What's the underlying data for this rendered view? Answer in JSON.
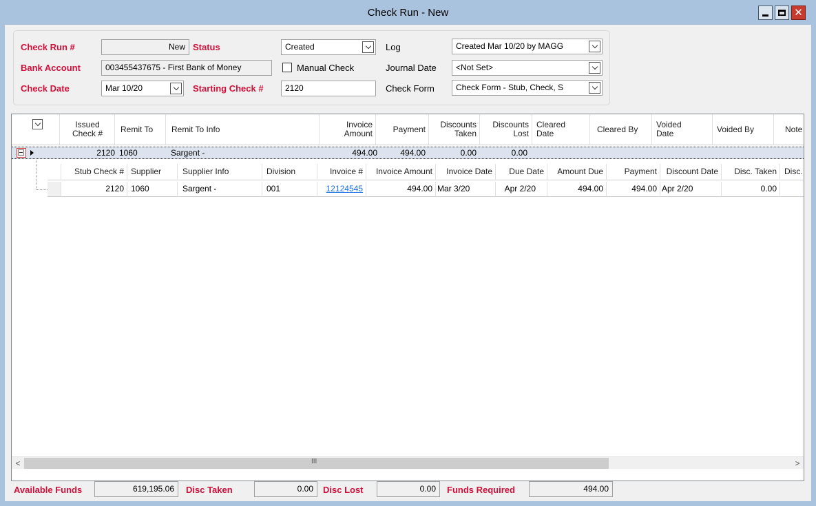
{
  "window": {
    "title": "Check Run - New"
  },
  "header": {
    "check_run_label": "Check Run #",
    "check_run_value": "New",
    "status_label": "Status",
    "status_value": "Created",
    "log_label": "Log",
    "log_value": "Created Mar 10/20 by MAGG",
    "bank_account_label": "Bank Account",
    "bank_account_value": "003455437675 - First Bank of Money",
    "manual_check_label": "Manual Check",
    "journal_date_label": "Journal Date",
    "journal_date_value": "<Not Set>",
    "check_date_label": "Check Date",
    "check_date_value": "Mar 10/20",
    "starting_check_label": "Starting Check #",
    "starting_check_value": "2120",
    "check_form_label": "Check Form",
    "check_form_value": "Check Form - Stub, Check, S"
  },
  "grid": {
    "columns": {
      "issued_check_1": "Issued",
      "issued_check_2": "Check #",
      "remit_to": "Remit To",
      "remit_to_info": "Remit To Info",
      "invoice_amount_1": "Invoice",
      "invoice_amount_2": "Amount",
      "payment": "Payment",
      "discounts_taken_1": "Discounts",
      "discounts_taken_2": "Taken",
      "discounts_lost_1": "Discounts",
      "discounts_lost_2": "Lost",
      "cleared_date_1": "Cleared",
      "cleared_date_2": "Date",
      "cleared_by": "Cleared By",
      "voided_date_1": "Voided",
      "voided_date_2": "Date",
      "voided_by": "Voided By",
      "note": "Note"
    },
    "row": {
      "issued_check": "2120",
      "remit_to": "1060",
      "remit_to_info": "Sargent -",
      "invoice_amount": "494.00",
      "payment": "494.00",
      "discounts_taken": "0.00",
      "discounts_lost": "0.00"
    },
    "sub_columns": {
      "stub_check": "Stub Check #",
      "supplier": "Supplier",
      "supplier_info": "Supplier Info",
      "division": "Division",
      "invoice_no": "Invoice #",
      "invoice_amount": "Invoice Amount",
      "invoice_date": "Invoice Date",
      "due_date": "Due Date",
      "amount_due": "Amount Due",
      "payment": "Payment",
      "discount_date": "Discount Date",
      "disc_taken": "Disc. Taken",
      "disc_more": "Disc."
    },
    "sub_row": {
      "stub_check": "2120",
      "supplier": "1060",
      "supplier_info": "Sargent -",
      "division": "001",
      "invoice_no": "12124545",
      "invoice_amount": "494.00",
      "invoice_date": "Mar 3/20",
      "due_date": "Apr 2/20",
      "amount_due": "494.00",
      "payment": "494.00",
      "discount_date": "Apr 2/20",
      "disc_taken": "0.00"
    },
    "scroll_grip": "III"
  },
  "footer": {
    "available_funds_label": "Available Funds",
    "available_funds_value": "619,195.06",
    "disc_taken_label": "Disc Taken",
    "disc_taken_value": "0.00",
    "disc_lost_label": "Disc Lost",
    "disc_lost_value": "0.00",
    "funds_required_label": "Funds Required",
    "funds_required_value": "494.00"
  },
  "colors": {
    "title_bar": "#a9c3de",
    "label_red": "#d0103a",
    "selected_row": "#dde3ee",
    "link": "#1a6ee0",
    "close_button": "#c73b2f"
  },
  "icons": [
    "minimize-icon",
    "maximize-icon",
    "close-icon",
    "chevron-down-icon",
    "collapse-icon",
    "row-pointer-icon",
    "scroll-left-icon",
    "scroll-right-icon"
  ]
}
